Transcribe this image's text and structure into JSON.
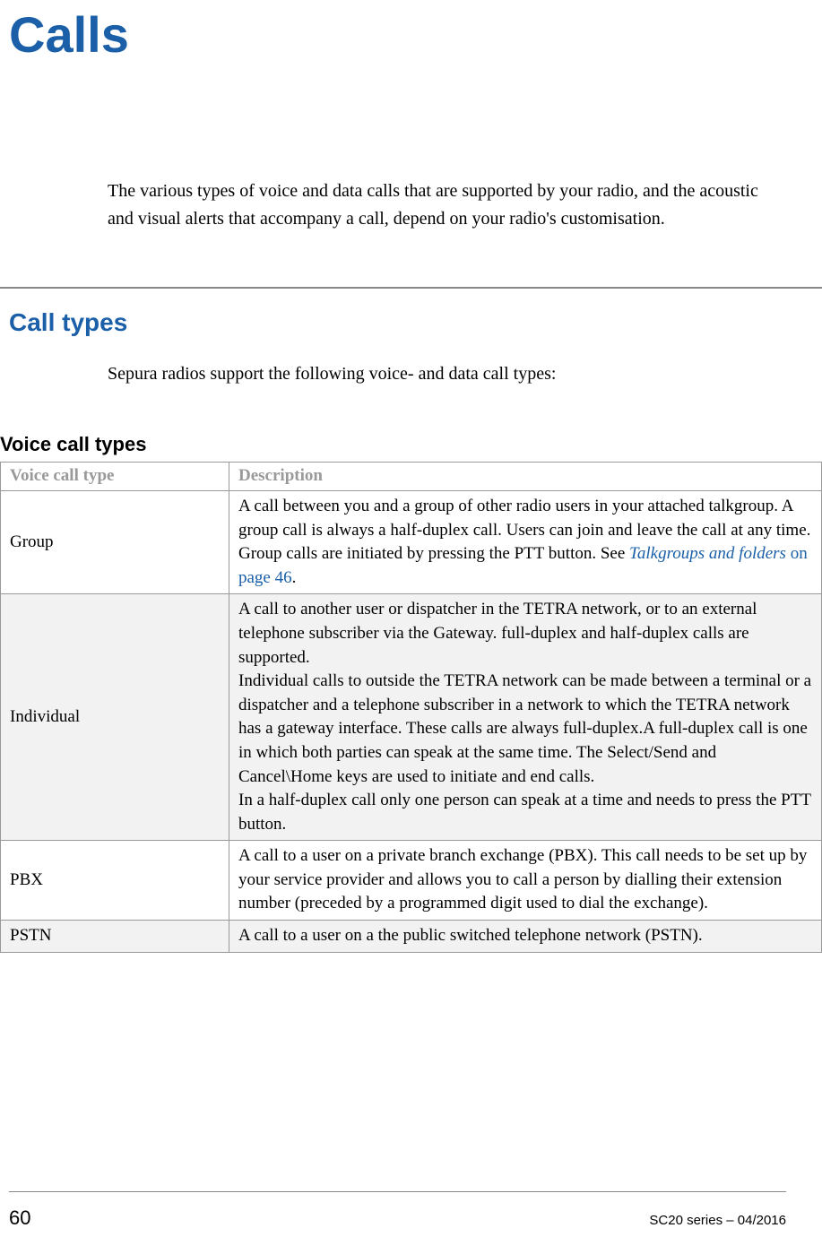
{
  "chapter": {
    "title": "Calls"
  },
  "intro": {
    "text": "The various types of voice and data calls that are supported by your radio, and the acoustic and visual alerts that accompany a call, depend on your radio's customisation."
  },
  "section": {
    "heading": "Call types",
    "text": "Sepura radios support the following voice- and data call types:"
  },
  "subsection": {
    "heading": "Voice call types"
  },
  "table": {
    "headers": {
      "col1": "Voice call type",
      "col2": "Description"
    },
    "rows": {
      "group": {
        "type": "Group",
        "desc_prefix": "A call between you and a group of other radio users in your attached talkgroup. A group call is always a half-duplex call. Users can join and leave the call at any time. Group calls are initiated by pressing the PTT button. See ",
        "link_italic": "Talkgroups and folders",
        "link_plain": " on page 46",
        "desc_suffix": "."
      },
      "individual": {
        "type": "Individual",
        "desc": "A call to another user or dispatcher in the TETRA network, or to an external telephone subscriber via the Gateway. full-duplex and half-duplex calls are supported.\nIndividual calls to outside the TETRA network can be made between a terminal or a dispatcher and a telephone subscriber in a network to which the TETRA network has a gateway interface. These calls are always full-duplex.A full-duplex call is one in which both parties can speak at the same time. The Select/Send and Cancel\\Home keys are used to initiate and end calls.\nIn a half-duplex call only one person can speak at a time and needs to press the PTT button."
      },
      "pbx": {
        "type": "PBX",
        "desc": "A call to a user on a private branch exchange (PBX). This call needs to be set up by your service provider and allows you to call a person by dialling their extension number (preceded by a programmed digit used to dial the exchange)."
      },
      "pstn": {
        "type": "PSTN",
        "desc": "A call to a user on a the public switched telephone network (PSTN)."
      }
    }
  },
  "footer": {
    "page_number": "60",
    "right": "SC20 series – 04/2016"
  }
}
